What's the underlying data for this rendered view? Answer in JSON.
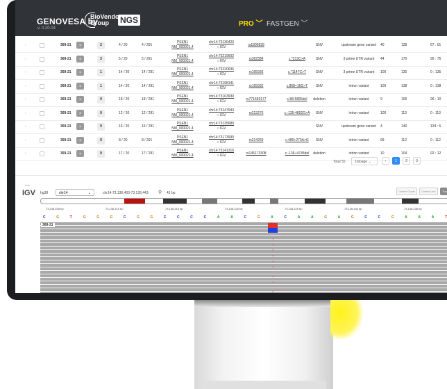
{
  "app": {
    "brand": "GENOVESA by",
    "version": "v. 0.20.04",
    "partner_line1": "BioVendor",
    "partner_line2": "Group",
    "product_badge": "NGS",
    "nav_pro": "PRO",
    "nav_fastgen": "FASTGEN",
    "accent": "#ffe100"
  },
  "variants": {
    "rows": [
      {
        "sample": "369-21",
        "count": "2",
        "af": "4 / 20",
        "dp": "4 / 291",
        "gene": "PSEN1",
        "transcript": "NM_000021.4",
        "locus": "chr14:73136423",
        "igv": "IGV",
        "rs": "rs1800839",
        "hgvs": "",
        "type": "SNV",
        "consequence": "upstream gene variant",
        "n1": "40",
        "n2": "128",
        "ratio": "67 : 61"
      },
      {
        "sample": "369-21",
        "count": "3",
        "af": "5 / 20",
        "dp": "5 / 291",
        "gene": "PSEN1",
        "transcript": "NM_000021.4",
        "locus": "chr14:73219602",
        "igv": "IGV",
        "rs": "rs362384",
        "hgvs": "c.*213C>A",
        "type": "SNV",
        "consequence": "3 prime UTR variant",
        "n1": "44",
        "n2": "170",
        "ratio": "95 : 75"
      },
      {
        "sample": "369-21",
        "count": "1",
        "af": "14 / 20",
        "dp": "14 / 291",
        "gene": "PSEN1",
        "transcript": "NM_000021.4",
        "locus": "chr14:73220636",
        "igv": "IGV",
        "rs": "rs165935",
        "hgvs": "c.*1147C>T",
        "type": "SNV",
        "consequence": "3 prime UTR variant",
        "n1": "100",
        "n2": "135",
        "ratio": "0 : 135"
      },
      {
        "sample": "369-21",
        "count": "1",
        "af": "14 / 20",
        "dp": "14 / 291",
        "gene": "PSEN1",
        "transcript": "NM_000021.4",
        "locus": "chr14:73198141",
        "igv": "IGV",
        "rs": "rs165932",
        "hgvs": "c.868+16G>T",
        "type": "SNV",
        "consequence": "intron variant",
        "n1": "100",
        "n2": "138",
        "ratio": "0 : 138"
      },
      {
        "sample": "369-21",
        "count": "0",
        "af": "18 / 20",
        "dp": "18 / 291",
        "gene": "PSEN1",
        "transcript": "NM_000021.4",
        "locus": "chr14:73163930",
        "igv": "IGV",
        "rs": "rs771659177",
        "hgvs": "c.88-6855del",
        "type": "deletion",
        "consequence": "intron variant",
        "n1": "9",
        "n2": "106",
        "ratio": "96 : 10"
      },
      {
        "sample": "369-21",
        "count": "0",
        "af": "12 / 20",
        "dp": "12 / 291",
        "gene": "PSEN1",
        "transcript": "NM_000021.4",
        "locus": "chr14:73147943",
        "igv": "IGV",
        "rs": "rs213276",
        "hgvs": "c.-135-4852G>A",
        "type": "SNV",
        "consequence": "intron variant",
        "n1": "100",
        "n2": "113",
        "ratio": "0 : 113"
      },
      {
        "sample": "369-21",
        "count": "0",
        "af": "16 / 20",
        "dp": "16 / 291",
        "gene": "PSEN1",
        "transcript": "NM_000021.4",
        "locus": "chr14:73135689",
        "igv": "IGV",
        "rs": "",
        "hgvs": "",
        "type": "SNV",
        "consequence": "upstream gene variant",
        "n1": "4",
        "n2": "140",
        "ratio": "134 : 6"
      },
      {
        "sample": "369-21",
        "count": "0",
        "af": "8 / 20",
        "dp": "8 / 291",
        "gene": "PSEN1",
        "transcript": "NM_000021.4",
        "locus": "chr14:73173930",
        "igv": "IGV",
        "rs": "rs214259",
        "hgvs": "c.480+273A>G",
        "type": "SNV",
        "consequence": "intron variant",
        "n1": "99",
        "n2": "112",
        "ratio": "0 : 112"
      },
      {
        "sample": "369-21",
        "count": "0",
        "af": "17 / 20",
        "dp": "17 / 291",
        "gene": "PSEN1",
        "transcript": "NM_000021.4",
        "locus": "chr14:73141316",
        "igv": "IGV",
        "rs": "rs145173308",
        "hgvs": "c.-136+4745del",
        "type": "deletion",
        "consequence": "intron variant",
        "n1": "10",
        "n2": "104",
        "ratio": "92 : 12"
      }
    ],
    "pager": {
      "total": "Total 55",
      "per_page": "10/page",
      "pages": [
        "1",
        "2",
        "3"
      ]
    }
  },
  "igv": {
    "logo": "IGV",
    "genome": "hg38",
    "chromosome": "chr14",
    "locus": "chr14:73,136,403-73,136,443",
    "width": "41 bp",
    "buttons": [
      "Center Guide",
      "Center Line",
      "Track Labels"
    ],
    "ruler": [
      "73,136,405 bp",
      "73,136,410 bp",
      "73,136,415 bp",
      "73,136,420 bp",
      "73,136,425 bp",
      "73,136,430 bp",
      "73,136,435 bp"
    ],
    "sequence": [
      "C",
      "G",
      "T",
      "G",
      "G",
      "G",
      "C",
      "G",
      "G",
      "C",
      "C",
      "C",
      "C",
      "A",
      "A",
      "C",
      "G",
      "A",
      "C",
      "A",
      "A",
      "G",
      "A",
      "G",
      "C",
      "C",
      "G",
      "A",
      "A",
      "A",
      "T"
    ],
    "track": "369-21",
    "base_colors": {
      "A": "#1a9a1a",
      "C": "#1a3ad6",
      "G": "#c47a00",
      "T": "#d61a1a"
    }
  }
}
